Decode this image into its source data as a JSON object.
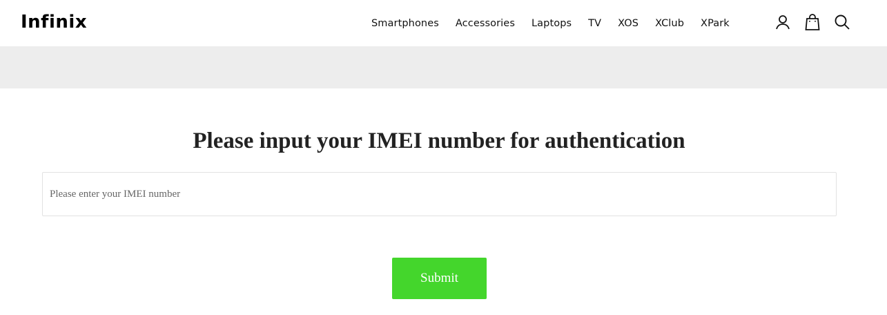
{
  "header": {
    "logo": "Infinix",
    "nav": [
      "Smartphones",
      "Accessories",
      "Laptops",
      "TV",
      "XOS",
      "XClub",
      "XPark"
    ],
    "icons": [
      "user-icon",
      "shopping-bag-icon",
      "search-icon"
    ]
  },
  "main": {
    "title": "Please input your IMEI number for authentication",
    "input_placeholder": "Please enter your IMEI number",
    "input_value": "",
    "submit_label": "Submit"
  },
  "colors": {
    "accent": "#44d62c",
    "banner": "#ededed",
    "text": "#222222"
  }
}
